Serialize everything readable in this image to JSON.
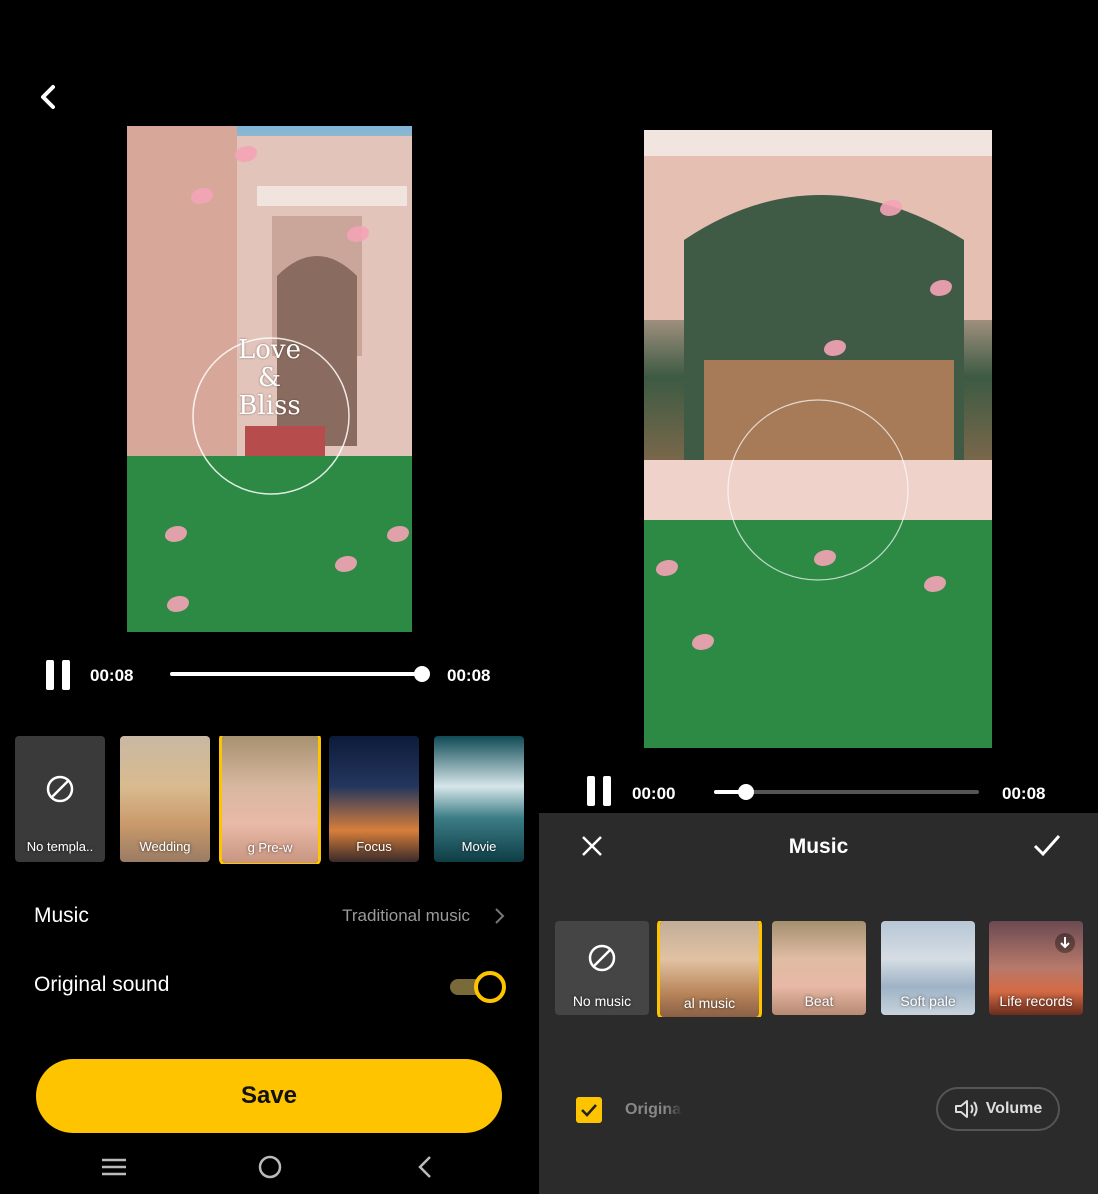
{
  "left": {
    "player": {
      "current": "00:08",
      "total": "00:08",
      "progress": 1.0
    },
    "templates": [
      {
        "label": "No templa..",
        "type": "none"
      },
      {
        "label": "Wedding",
        "type": "thumb"
      },
      {
        "label": "g   Pre-w",
        "type": "thumb",
        "selected": true
      },
      {
        "label": "Focus",
        "type": "thumb"
      },
      {
        "label": "Movie",
        "type": "thumb"
      }
    ],
    "music_row": {
      "label": "Music",
      "value": "Traditional music"
    },
    "sound_row": {
      "label": "Original sound",
      "enabled": true
    },
    "save_label": "Save",
    "preview_text": {
      "line1": "Love",
      "line2": "&",
      "line3": "Bliss"
    }
  },
  "right": {
    "player": {
      "current": "00:00",
      "total": "00:08",
      "progress": 0.12
    },
    "sheet_title": "Music",
    "music": [
      {
        "label": "No music",
        "type": "none"
      },
      {
        "label": "al music",
        "type": "thumb",
        "selected": true
      },
      {
        "label": "Beat",
        "type": "thumb"
      },
      {
        "label": "Soft pale",
        "type": "thumb"
      },
      {
        "label": "Life records",
        "type": "thumb",
        "download": true
      }
    ],
    "original_label": "Original",
    "original_checked": true,
    "volume_label": "Volume"
  },
  "colors": {
    "accent": "#ffc400",
    "sheet": "#2b2b2b",
    "background": "#000000"
  }
}
